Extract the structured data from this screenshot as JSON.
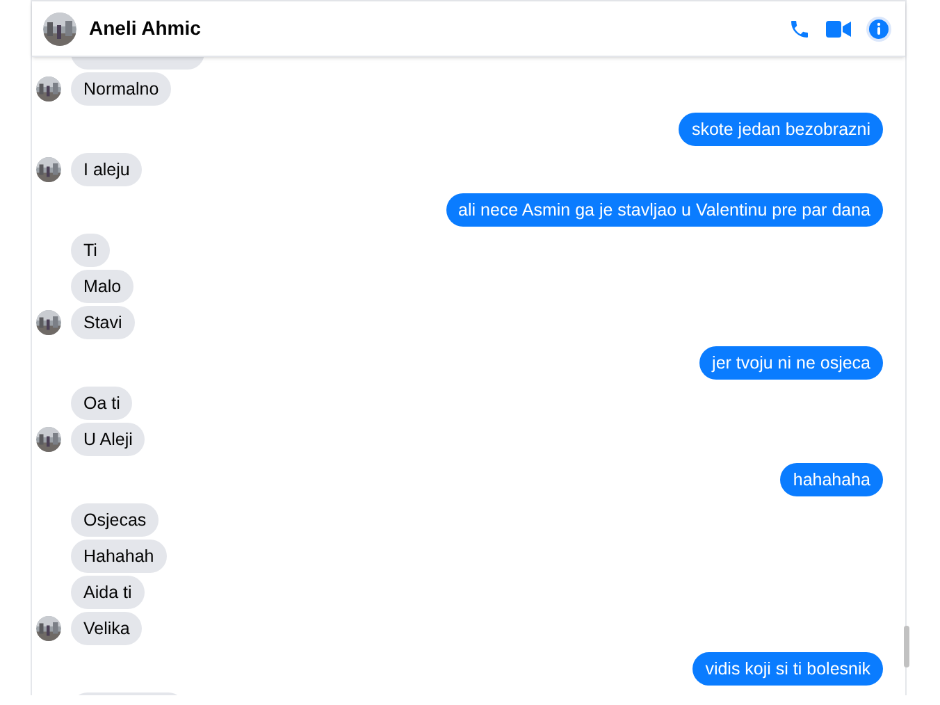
{
  "header": {
    "name": "Aneli Ahmic"
  },
  "messages": [
    {
      "kind": "received"
    },
    {
      "kind": "received",
      "text": "Normalno"
    },
    {
      "kind": "sent",
      "text": "skote jedan bezobrazni"
    },
    {
      "kind": "received",
      "text": "I aleju"
    },
    {
      "kind": "sent",
      "text": "ali nece Asmin ga je stavljao u Valentinu pre par dana"
    },
    {
      "kind": "received",
      "text": "Ti"
    },
    {
      "kind": "received",
      "text": "Malo"
    },
    {
      "kind": "received",
      "text": "Stavi"
    },
    {
      "kind": "sent",
      "text": "jer tvoju ni ne osjeca"
    },
    {
      "kind": "received",
      "text": "Oa ti"
    },
    {
      "kind": "received",
      "text": "U Aleji"
    },
    {
      "kind": "sent",
      "text": "hahahaha"
    },
    {
      "kind": "received",
      "text": "Osjecas"
    },
    {
      "kind": "received",
      "text": "Hahahah"
    },
    {
      "kind": "received",
      "text": "Aida ti"
    },
    {
      "kind": "received",
      "text": "Velika"
    },
    {
      "kind": "sent",
      "text": "vidis koji si ti bolesnik"
    },
    {
      "kind": "received"
    }
  ]
}
